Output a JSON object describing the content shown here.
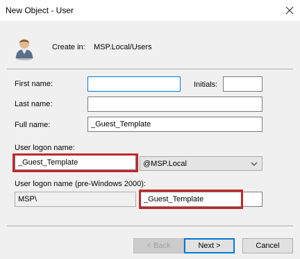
{
  "window": {
    "title": "New Object - User"
  },
  "header": {
    "create_in_label": "Create in:",
    "create_in_value": "MSP.Local/Users"
  },
  "form": {
    "first_name": {
      "label": "First name:",
      "value": ""
    },
    "initials": {
      "label": "Initials:",
      "value": ""
    },
    "last_name": {
      "label": "Last name:",
      "value": ""
    },
    "full_name": {
      "label": "Full name:",
      "value": "_Guest_Template"
    },
    "logon_name": {
      "label": "User logon name:",
      "value": "_Guest_Template"
    },
    "domain": {
      "selected": "@MSP.Local"
    },
    "pre2000": {
      "label": "User logon name (pre-Windows 2000):",
      "domain_value": "MSP\\",
      "value": "_Guest_Template"
    }
  },
  "buttons": {
    "back": "< Back",
    "next": "Next >",
    "cancel": "Cancel"
  },
  "colors": {
    "highlight": "#c0272d",
    "focus": "#0078d7"
  },
  "icons": [
    "close-icon",
    "user-icon",
    "chevron-down-icon"
  ]
}
